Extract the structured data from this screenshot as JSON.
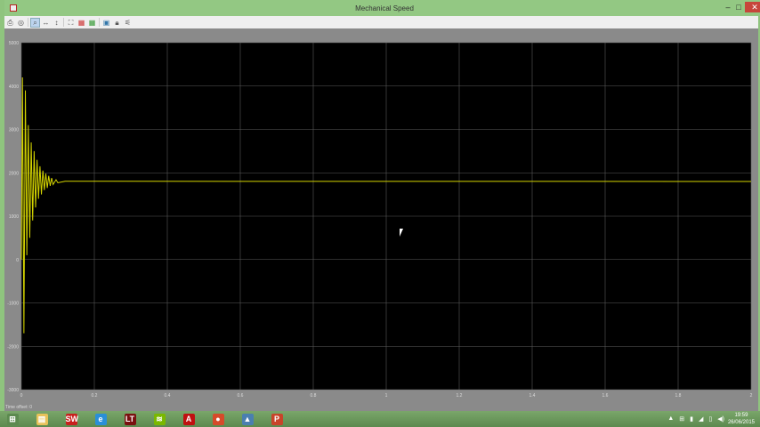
{
  "window": {
    "title": "Mechanical Speed",
    "minimize": "–",
    "maximize": "□",
    "close": "✕"
  },
  "toolbar": {
    "icons": [
      "print-icon",
      "print-preview-icon",
      "zoom-in-icon",
      "zoom-x-icon",
      "zoom-y-icon",
      "autoscale-icon",
      "save-axes-icon",
      "restore-axes-icon",
      "parameters-icon",
      "lock-icon",
      "signal-selector-icon"
    ]
  },
  "footer": {
    "time_offset_label": "Time offset:",
    "time_offset_value": "0"
  },
  "chart_data": {
    "type": "line",
    "title": "Mechanical Speed",
    "xlabel": "",
    "ylabel": "",
    "xlim": [
      0,
      2
    ],
    "ylim": [
      -3000,
      5000
    ],
    "xticks": [
      0,
      0.2,
      0.4,
      0.6,
      0.8,
      1,
      1.2,
      1.4,
      1.6,
      1.8,
      2
    ],
    "xtick_labels": [
      "0",
      "0.2",
      "0.4",
      "0.6",
      "0.8",
      "1",
      "1.2",
      "1.4",
      "1.6",
      "1.8",
      "2"
    ],
    "yticks": [
      -3000,
      -2000,
      -1000,
      0,
      1000,
      2000,
      3000,
      4000,
      5000
    ],
    "ytick_labels": [
      "-3000",
      "-2000",
      "-1000",
      "0",
      "1000",
      "2000",
      "3000",
      "4000",
      "5000"
    ],
    "grid": true,
    "background": "#000000",
    "grid_color": "#5a5a5a",
    "line_color": "#d4d400",
    "series": [
      {
        "name": "Mechanical Speed",
        "points": [
          [
            0,
            0
          ],
          [
            0.003,
            4200
          ],
          [
            0.007,
            -1700
          ],
          [
            0.011,
            3900
          ],
          [
            0.015,
            100
          ],
          [
            0.019,
            3100
          ],
          [
            0.023,
            500
          ],
          [
            0.027,
            2700
          ],
          [
            0.031,
            900
          ],
          [
            0.035,
            2500
          ],
          [
            0.039,
            1200
          ],
          [
            0.043,
            2300
          ],
          [
            0.047,
            1400
          ],
          [
            0.051,
            2150
          ],
          [
            0.055,
            1500
          ],
          [
            0.059,
            2050
          ],
          [
            0.063,
            1600
          ],
          [
            0.067,
            1980
          ],
          [
            0.071,
            1650
          ],
          [
            0.075,
            1930
          ],
          [
            0.079,
            1700
          ],
          [
            0.083,
            1880
          ],
          [
            0.087,
            1730
          ],
          [
            0.095,
            1840
          ],
          [
            0.1,
            1770
          ],
          [
            0.12,
            1805
          ],
          [
            2,
            1800
          ]
        ]
      }
    ]
  },
  "taskbar": {
    "apps": [
      {
        "name": "start",
        "glyph": "⊞",
        "color": "#5c8a4f"
      },
      {
        "name": "file-explorer",
        "glyph": "▤",
        "color": "#e8c25a"
      },
      {
        "name": "solidworks",
        "glyph": "SW",
        "color": "#c8201e"
      },
      {
        "name": "internet-explorer",
        "glyph": "e",
        "color": "#2a8fd8"
      },
      {
        "name": "ltspice",
        "glyph": "LT",
        "color": "#7a1010"
      },
      {
        "name": "spotify",
        "glyph": "≋",
        "color": "#7ab800"
      },
      {
        "name": "acrobat",
        "glyph": "A",
        "color": "#c01010"
      },
      {
        "name": "chrome",
        "glyph": "●",
        "color": "#d64a2a"
      },
      {
        "name": "matlab",
        "glyph": "▲",
        "color": "#4a7fb0"
      },
      {
        "name": "powerpoint",
        "glyph": "P",
        "color": "#c8442a"
      }
    ],
    "clock_time": "19:59",
    "clock_date": "26/06/2015"
  }
}
